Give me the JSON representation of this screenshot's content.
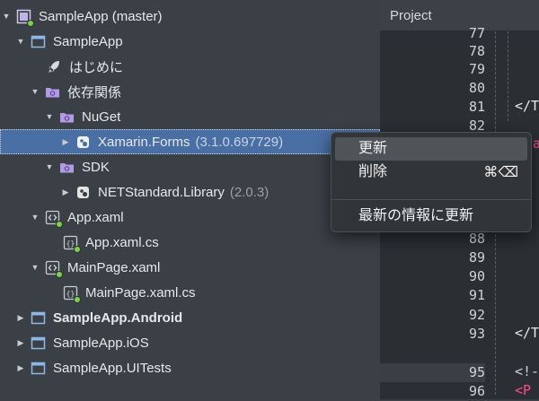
{
  "tree": {
    "solution": {
      "label": "SampleApp (master)"
    },
    "project": {
      "label": "SampleApp"
    },
    "getting_started": {
      "label": "はじめに"
    },
    "dependencies": {
      "label": "依存関係"
    },
    "nuget": {
      "label": "NuGet"
    },
    "xamarin_forms": {
      "label": "Xamarin.Forms",
      "version": "(3.1.0.697729)"
    },
    "sdk": {
      "label": "SDK"
    },
    "netstandard": {
      "label": "NETStandard.Library",
      "version": "(2.0.3)"
    },
    "app_xaml": {
      "label": "App.xaml"
    },
    "app_xaml_cs": {
      "label": "App.xaml.cs"
    },
    "mainpage_xaml": {
      "label": "MainPage.xaml"
    },
    "mainpage_xaml_cs": {
      "label": "MainPage.xaml.cs"
    },
    "android": {
      "label": "SampleApp.Android"
    },
    "ios": {
      "label": "SampleApp.iOS"
    },
    "uitests": {
      "label": "SampleApp.UITests"
    }
  },
  "editor": {
    "header": "Project",
    "line_numbers": [
      "77",
      "78",
      "79",
      "80",
      "81",
      "82",
      "88",
      "89",
      "90",
      "91",
      "92",
      "93",
      "95",
      "96"
    ],
    "code_81": "</T",
    "code_82": "a",
    "code_93": "</T",
    "code_95": "<!-",
    "code_96": "<P"
  },
  "context_menu": {
    "items": [
      {
        "label": "更新"
      },
      {
        "label": "削除",
        "shortcut": "⌘⌫"
      },
      {
        "label": "最新の情報に更新"
      }
    ]
  },
  "colors": {
    "selection": "#4a6fa5",
    "tree_bg": "#3b4046",
    "editor_bg": "#2b2f34",
    "tag": "#ff4b8a",
    "badge": "#7cd34a"
  }
}
